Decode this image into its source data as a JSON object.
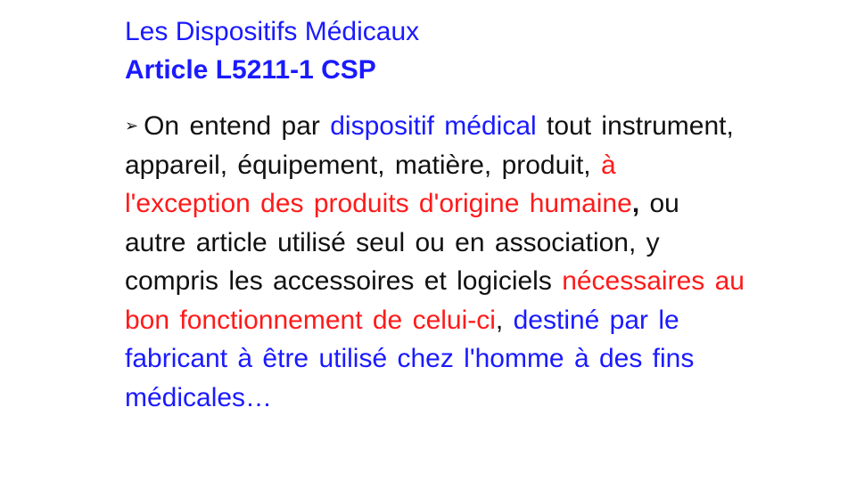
{
  "slide": {
    "title_line1": "Les Dispositifs Médicaux",
    "title_line2": "Article L5211-1 CSP",
    "bullet_glyph": "➢",
    "text": {
      "p1": "On entend par",
      "term": "dispositif médical",
      "p2": "tout instrument, appareil, équipement, matière, produit,",
      "exception": "à l'exception des produits d'origine humaine",
      "comma": ",",
      "p3": "ou autre article utilisé seul ou en association, y compris les accessoires et logiciels",
      "necessary": "nécessaires au bon fonctionnement de celui-ci",
      "p4": ",",
      "purpose": "destiné par le fabricant à être utilisé chez l'homme à des fins médicales…"
    },
    "colors": {
      "blue": "#1a1aff",
      "red": "#ff1a1a",
      "text": "#111111"
    }
  }
}
